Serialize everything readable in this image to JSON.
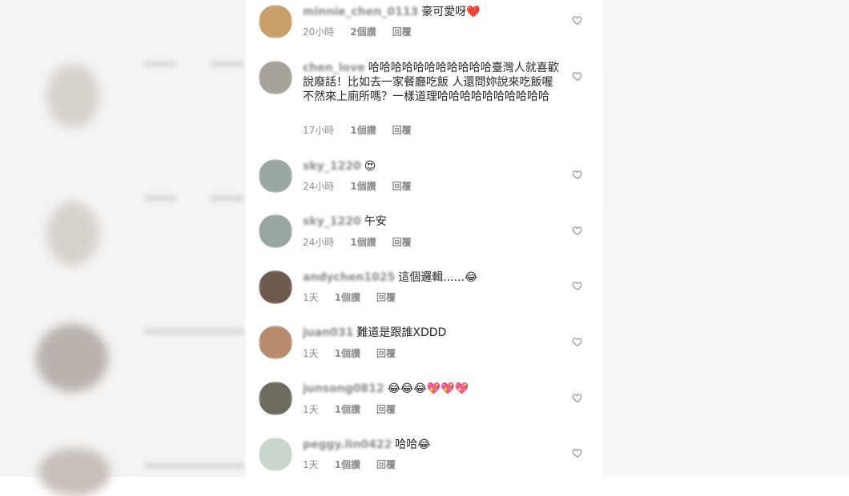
{
  "comments": [
    {
      "username": "minnie_chen_0113",
      "text": "豪可愛呀❤️",
      "time": "20小時",
      "likes": "2個讚",
      "reply": "回覆",
      "avatar_color": "#c9a06a"
    },
    {
      "username": "chen_love",
      "text": "哈哈哈哈哈哈哈哈哈哈哈臺灣人就喜歡說廢話！比如去一家餐廳吃飯 人還問妳說來吃飯喔 不然來上廁所嗎？一樣道理哈哈哈哈哈哈哈哈哈哈",
      "time": "17小時",
      "likes": "1個讚",
      "reply": "回覆",
      "avatar_color": "#a7a29a"
    },
    {
      "username": "sky_1220",
      "text": "😍",
      "time": "24小時",
      "likes": "1個讚",
      "reply": "回覆",
      "avatar_color": "#9aa6a0"
    },
    {
      "username": "sky_1220",
      "text": "午安",
      "time": "24小時",
      "likes": "1個讚",
      "reply": "回覆",
      "avatar_color": "#9aa6a0"
    },
    {
      "username": "andychen1025",
      "text": "這個邏輯......😂",
      "time": "1天",
      "likes": "1個讚",
      "reply": "回覆",
      "avatar_color": "#6f5a4e"
    },
    {
      "username": "juan031",
      "text": "難道是跟誰XDDD",
      "time": "1天",
      "likes": "1個讚",
      "reply": "回覆",
      "avatar_color": "#b88a6e"
    },
    {
      "username": "junsong0812",
      "text": "😂😂😂💖💖💖",
      "time": "1天",
      "likes": "1個讚",
      "reply": "回覆",
      "avatar_color": "#6d6a5e"
    },
    {
      "username": "peggy.lin0422",
      "text": "哈哈😂",
      "time": "1天",
      "likes": "1個讚",
      "reply": "回覆",
      "avatar_color": "#c8d4cc"
    }
  ],
  "icons": {
    "like": "heart-outline-icon"
  }
}
